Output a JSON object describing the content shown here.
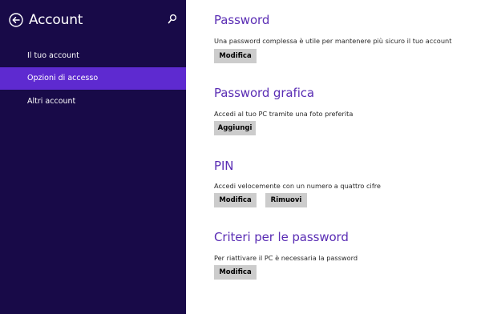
{
  "sidebar": {
    "title": "Account",
    "nav_items": [
      {
        "label": "Il tuo account",
        "selected": false
      },
      {
        "label": "Opzioni di accesso",
        "selected": true
      },
      {
        "label": "Altri account",
        "selected": false
      }
    ]
  },
  "sections": [
    {
      "title": "Password",
      "description": "Una password complessa è utile per mantenere più sicuro il tuo account",
      "buttons": [
        "Modifica"
      ]
    },
    {
      "title": "Password grafica",
      "description": "Accedi al tuo PC tramite una foto preferita",
      "buttons": [
        "Aggiungi"
      ]
    },
    {
      "title": "PIN",
      "description": "Accedi velocemente con un numero a quattro cifre",
      "buttons": [
        "Modifica",
        "Rimuovi"
      ]
    },
    {
      "title": "Criteri per le password",
      "description": "Per riattivare il PC è necessaria la password",
      "buttons": [
        "Modifica"
      ]
    }
  ],
  "colors": {
    "sidebar_background": "#180a48",
    "selected_item": "#5e2ad0",
    "heading_accent": "#5a2db4",
    "button_background": "#cccccc"
  },
  "icons": {
    "back": "back-arrow-circle-icon",
    "search": "search-icon"
  }
}
